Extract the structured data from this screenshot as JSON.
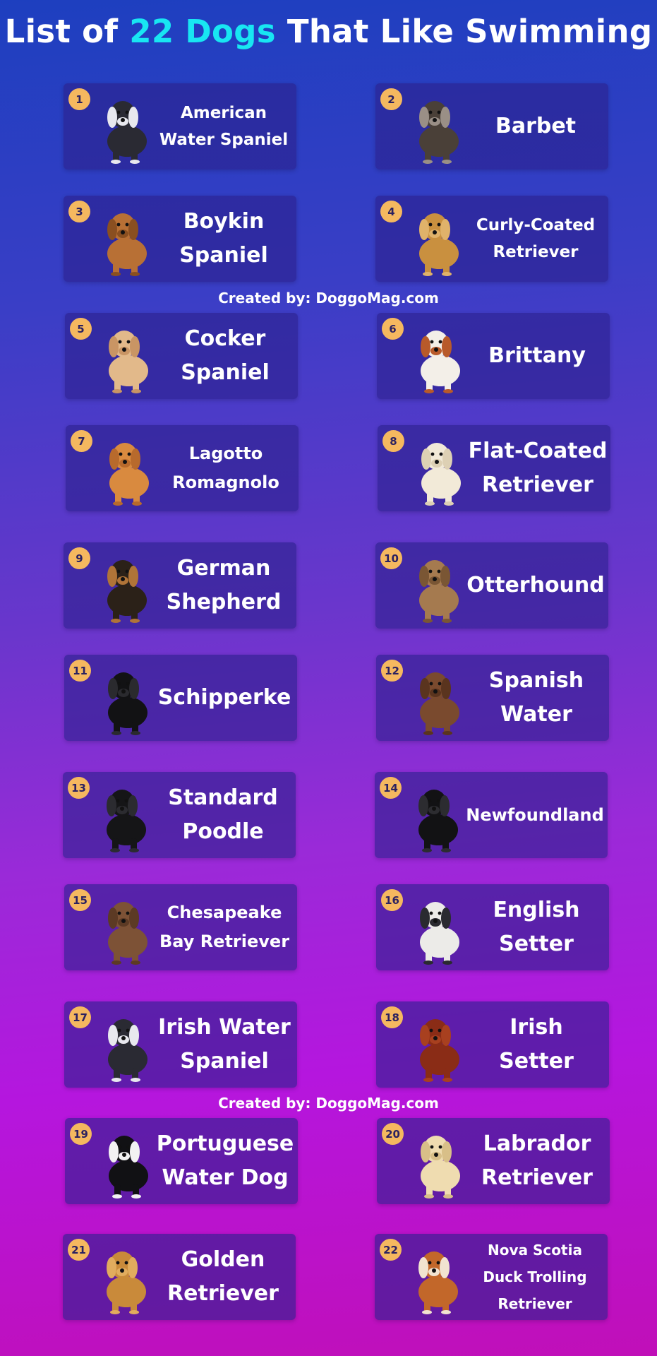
{
  "header": {
    "title_prefix": "List of",
    "title_accent": "22 Dogs",
    "title_suffix": "That Like Swimming"
  },
  "credit_text": "Created by: DoggoMag.com",
  "colors": {
    "accent": "#18e6f2",
    "badge": "#f5b85f",
    "card": "#2c208c"
  },
  "dogs": [
    {
      "num": "1",
      "lines": [
        "American",
        "Water Spaniel"
      ],
      "coat": "#2a2a33",
      "coat2": "#e8e8ee"
    },
    {
      "num": "2",
      "lines": [
        "Barbet"
      ],
      "coat": "#4a4038",
      "coat2": "#9a8f86"
    },
    {
      "num": "3",
      "lines": [
        "Boykin",
        "Spaniel"
      ],
      "coat": "#b87035",
      "coat2": "#8a4f20"
    },
    {
      "num": "4",
      "lines": [
        "Curly-Coated",
        "Retriever"
      ],
      "coat": "#c9903f",
      "coat2": "#e0b26a"
    },
    {
      "num": "5",
      "lines": [
        "Cocker",
        "Spaniel"
      ],
      "coat": "#e2b98a",
      "coat2": "#c99564"
    },
    {
      "num": "6",
      "lines": [
        "Brittany"
      ],
      "coat": "#f3efe8",
      "coat2": "#b85a2a"
    },
    {
      "num": "7",
      "lines": [
        "Lagotto",
        "Romagnolo"
      ],
      "coat": "#d98a3f",
      "coat2": "#b86a2c"
    },
    {
      "num": "8",
      "lines": [
        "Flat-Coated",
        "Retriever"
      ],
      "coat": "#f2ead8",
      "coat2": "#ddd0b4"
    },
    {
      "num": "9",
      "lines": [
        "German",
        "Shepherd"
      ],
      "coat": "#2b2118",
      "coat2": "#b07438"
    },
    {
      "num": "10",
      "lines": [
        "Otterhound"
      ],
      "coat": "#a57a4f",
      "coat2": "#7a5634"
    },
    {
      "num": "11",
      "lines": [
        "Schipperke"
      ],
      "coat": "#121214",
      "coat2": "#2a2a2e"
    },
    {
      "num": "12",
      "lines": [
        "Spanish",
        "Water"
      ],
      "coat": "#7a4a2e",
      "coat2": "#5a341e"
    },
    {
      "num": "13",
      "lines": [
        "Standard",
        "Poodle"
      ],
      "coat": "#151517",
      "coat2": "#2b2b30"
    },
    {
      "num": "14",
      "lines": [
        "Newfoundland"
      ],
      "coat": "#121214",
      "coat2": "#2c2c30"
    },
    {
      "num": "15",
      "lines": [
        "Chesapeake",
        "Bay Retriever"
      ],
      "coat": "#7d5236",
      "coat2": "#5c3a24"
    },
    {
      "num": "16",
      "lines": [
        "English",
        "Setter"
      ],
      "coat": "#ecebe8",
      "coat2": "#2a2a30"
    },
    {
      "num": "17",
      "lines": [
        "Irish Water",
        "Spaniel"
      ],
      "coat": "#2a2a33",
      "coat2": "#e8e8ee"
    },
    {
      "num": "18",
      "lines": [
        "Irish",
        "Setter"
      ],
      "coat": "#8a2c16",
      "coat2": "#a8401f"
    },
    {
      "num": "19",
      "lines": [
        "Portuguese",
        "Water Dog"
      ],
      "coat": "#111114",
      "coat2": "#f2f2f2"
    },
    {
      "num": "20",
      "lines": [
        "Labrador",
        "Retriever"
      ],
      "coat": "#efdcb0",
      "coat2": "#d8bf88"
    },
    {
      "num": "21",
      "lines": [
        "Golden",
        "Retriever"
      ],
      "coat": "#c98a3a",
      "coat2": "#e1ac5e"
    },
    {
      "num": "22",
      "lines": [
        "Nova Scotia",
        "Duck Trolling",
        "Retriever"
      ],
      "coat": "#c2672a",
      "coat2": "#f1e3d0"
    }
  ]
}
